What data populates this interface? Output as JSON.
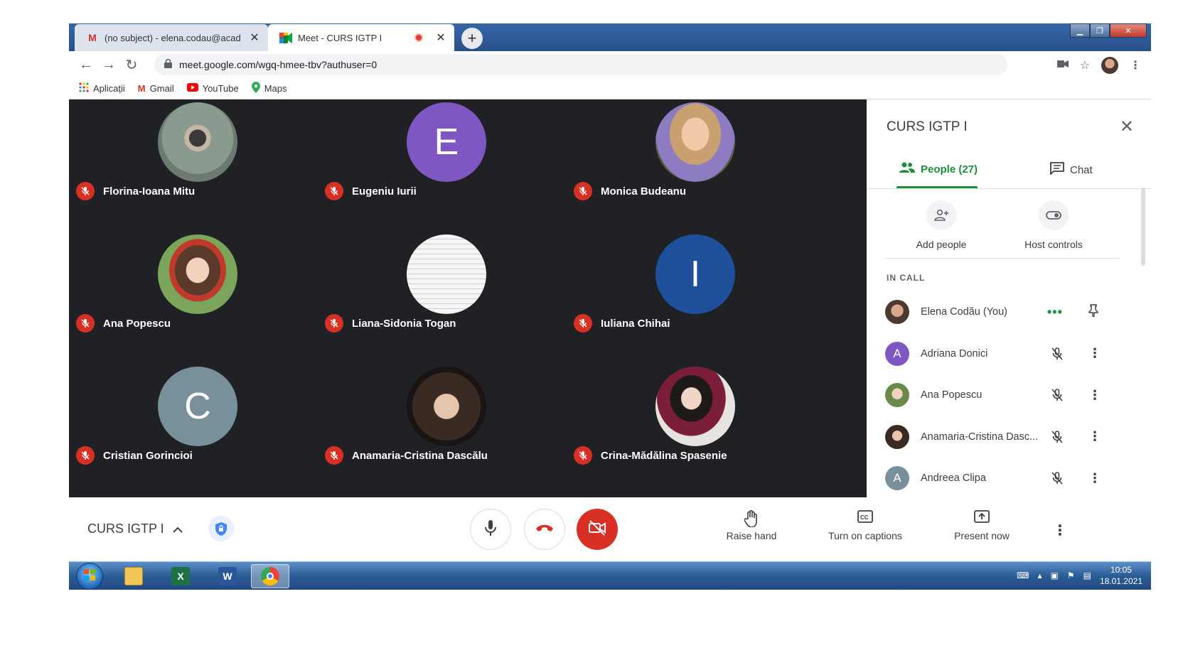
{
  "browser": {
    "tabs": [
      {
        "title": "(no subject) - elena.codau@acad",
        "favicon": "M",
        "active": false
      },
      {
        "title": "Meet - CURS IGTP I",
        "favicon": "meet-icon",
        "active": true
      }
    ],
    "new_tab": "+",
    "url": "meet.google.com/wgq-hmee-tbv?authuser=0",
    "bookmarks": [
      {
        "label": "Aplicații",
        "icon": "apps-grid-icon"
      },
      {
        "label": "Gmail",
        "icon": "gmail-icon"
      },
      {
        "label": "YouTube",
        "icon": "youtube-icon"
      },
      {
        "label": "Maps",
        "icon": "maps-pin-icon"
      }
    ]
  },
  "meeting": {
    "name": "CURS IGTP I",
    "participants_tiles": [
      {
        "name": "Florina-Ioana Mitu",
        "avatar_type": "photo",
        "color": "#7d8a84"
      },
      {
        "name": "Eugeniu Iurii",
        "avatar_type": "letter",
        "letter": "E",
        "color": "#7e57c2"
      },
      {
        "name": "Monica Budeanu",
        "avatar_type": "photo",
        "color": "#b58b6a"
      },
      {
        "name": "Ana Popescu",
        "avatar_type": "photo",
        "color": "#6a8a4a"
      },
      {
        "name": "Liana-Sidonia Togan",
        "avatar_type": "photo",
        "color": "#f4f4f4"
      },
      {
        "name": "Iuliana Chihai",
        "avatar_type": "letter",
        "letter": "I",
        "color": "#1e4f9a"
      },
      {
        "name": "Cristian Gorincioi",
        "avatar_type": "letter",
        "letter": "C",
        "color": "#78909c"
      },
      {
        "name": "Anamaria-Cristina Dascălu",
        "avatar_type": "photo",
        "color": "#5a4a48"
      },
      {
        "name": "Crina-Mădălina Spasenie",
        "avatar_type": "photo",
        "color": "#c9c2c0"
      }
    ]
  },
  "panel": {
    "title": "CURS IGTP I",
    "tabs": {
      "people": "People (27)",
      "chat": "Chat"
    },
    "actions": {
      "add_people": "Add people",
      "host_controls": "Host controls"
    },
    "section_label": "IN CALL",
    "people": [
      {
        "name": "Elena Codău (You)",
        "avatar_type": "photo",
        "color": "#8d6e63",
        "self": true
      },
      {
        "name": "Adriana Donici",
        "avatar_type": "letter",
        "letter": "A",
        "color": "#7e57c2"
      },
      {
        "name": "Ana Popescu",
        "avatar_type": "photo",
        "color": "#6a8a4a"
      },
      {
        "name": "Anamaria-Cristina Dasc...",
        "avatar_type": "photo",
        "color": "#5a4a48"
      },
      {
        "name": "Andreea Clipa",
        "avatar_type": "letter",
        "letter": "A",
        "color": "#78909c"
      }
    ]
  },
  "bottom_bar": {
    "meeting_name": "CURS IGTP I",
    "raise_hand": "Raise hand",
    "captions": "Turn on captions",
    "present": "Present now"
  },
  "taskbar": {
    "time": "10:05",
    "date": "18.01.2021"
  },
  "colors": {
    "stage_bg": "#202124",
    "accent_green": "#1e8e3e",
    "mute_red": "#d93025"
  }
}
